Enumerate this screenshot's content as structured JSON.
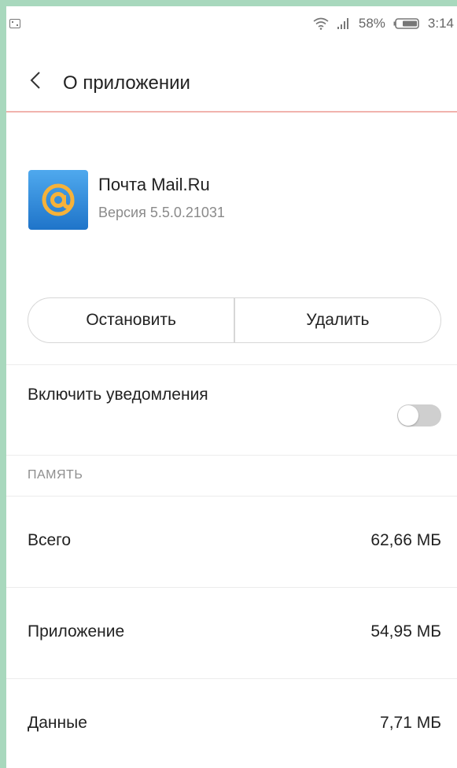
{
  "status_bar": {
    "battery_percent": "58%",
    "time": "3:14"
  },
  "header": {
    "title": "О приложении"
  },
  "app": {
    "name": "Почта Mail.Ru",
    "version": "Версия 5.5.0.21031"
  },
  "actions": {
    "stop_label": "Остановить",
    "delete_label": "Удалить"
  },
  "notifications": {
    "label": "Включить уведомления",
    "enabled": false
  },
  "storage": {
    "section_title": "ПАМЯТЬ",
    "rows": [
      {
        "label": "Всего",
        "value": "62,66 МБ"
      },
      {
        "label": "Приложение",
        "value": "54,95 МБ"
      },
      {
        "label": "Данные",
        "value": "7,71 МБ"
      }
    ]
  },
  "colors": {
    "accent_line": "#f1b3ad",
    "toggle_off": "#cfcfcf",
    "app_icon_top": "#4fa9ee",
    "app_icon_bottom": "#1f74c9"
  }
}
